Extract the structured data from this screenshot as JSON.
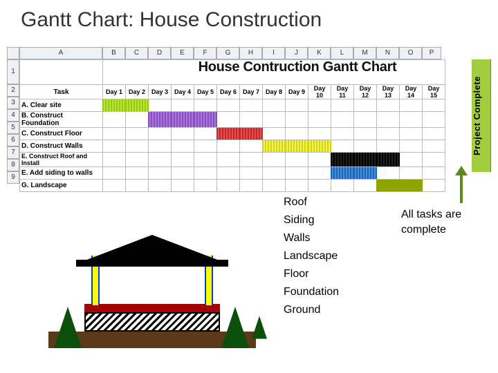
{
  "slide_title": "Gantt Chart: House Construction",
  "spreadsheet": {
    "columns": [
      "A",
      "B",
      "C",
      "D",
      "E",
      "F",
      "G",
      "H",
      "I",
      "J",
      "K",
      "L",
      "M",
      "N",
      "O",
      "P"
    ],
    "rows": [
      "1",
      "2",
      "3",
      "4",
      "5",
      "6",
      "7",
      "8",
      "9"
    ],
    "chart_title": "House Contruction Gantt Chart",
    "task_header": "Task",
    "day_headers": [
      "Day 1",
      "Day 2",
      "Day 3",
      "Day 4",
      "Day 5",
      "Day 6",
      "Day 7",
      "Day 8",
      "Day 9",
      "Day 10",
      "Day 11",
      "Day 12",
      "Day 13",
      "Day 14",
      "Day 15"
    ],
    "tasks": [
      {
        "label": "A. Clear site"
      },
      {
        "label": "B. Construct Foundation"
      },
      {
        "label": "C. Construct Floor"
      },
      {
        "label": "D. Construct Walls"
      },
      {
        "label": "E. Construct Roof and Install"
      },
      {
        "label": "E. Add siding to walls"
      },
      {
        "label": "G. Landscape"
      }
    ],
    "project_complete": "Project Complete"
  },
  "legend": {
    "roof": "Roof",
    "siding": "Siding",
    "walls": "Walls",
    "landscape": "Landscape",
    "floor": "Floor",
    "foundation": "Foundation",
    "ground": "Ground"
  },
  "note": "All tasks are complete",
  "chart_data": {
    "type": "bar",
    "title": "House Contruction Gantt Chart",
    "xlabel": "Day",
    "ylabel": "Task",
    "x_categories": [
      "Day 1",
      "Day 2",
      "Day 3",
      "Day 4",
      "Day 5",
      "Day 6",
      "Day 7",
      "Day 8",
      "Day 9",
      "Day 10",
      "Day 11",
      "Day 12",
      "Day 13",
      "Day 14",
      "Day 15"
    ],
    "series": [
      {
        "name": "A. Clear site",
        "start_day": 1,
        "end_day": 2,
        "color": "green"
      },
      {
        "name": "B. Construct Foundation",
        "start_day": 3,
        "end_day": 5,
        "color": "purple"
      },
      {
        "name": "C. Construct Floor",
        "start_day": 6,
        "end_day": 7,
        "color": "red"
      },
      {
        "name": "D. Construct Walls",
        "start_day": 8,
        "end_day": 10,
        "color": "yellow"
      },
      {
        "name": "E. Construct Roof and Install",
        "start_day": 11,
        "end_day": 13,
        "color": "black"
      },
      {
        "name": "E. Add siding to walls",
        "start_day": 11,
        "end_day": 12,
        "color": "blue"
      },
      {
        "name": "G. Landscape",
        "start_day": 13,
        "end_day": 14,
        "color": "olive"
      }
    ],
    "milestone": {
      "name": "Project Complete",
      "day": 15
    }
  }
}
